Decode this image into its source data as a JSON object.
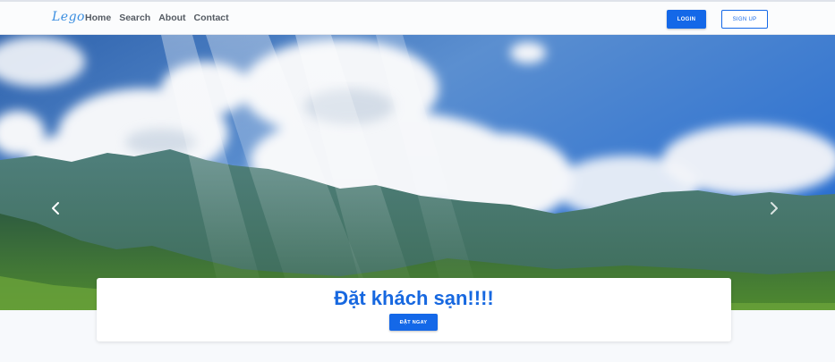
{
  "navbar": {
    "logo": "Lego",
    "links": [
      "Home",
      "Search",
      "About",
      "Contact"
    ],
    "login_label": "LOGIN",
    "signup_label": "SIGN UP"
  },
  "hero": {
    "prev_icon": "chevron-left-icon",
    "next_icon": "chevron-right-icon"
  },
  "booking": {
    "title": "Đặt khách sạn!!!!",
    "button_label": "ĐẶT NGAY"
  },
  "colors": {
    "primary": "#1468e8",
    "title": "#1768e0",
    "nav_text": "#555b63"
  }
}
